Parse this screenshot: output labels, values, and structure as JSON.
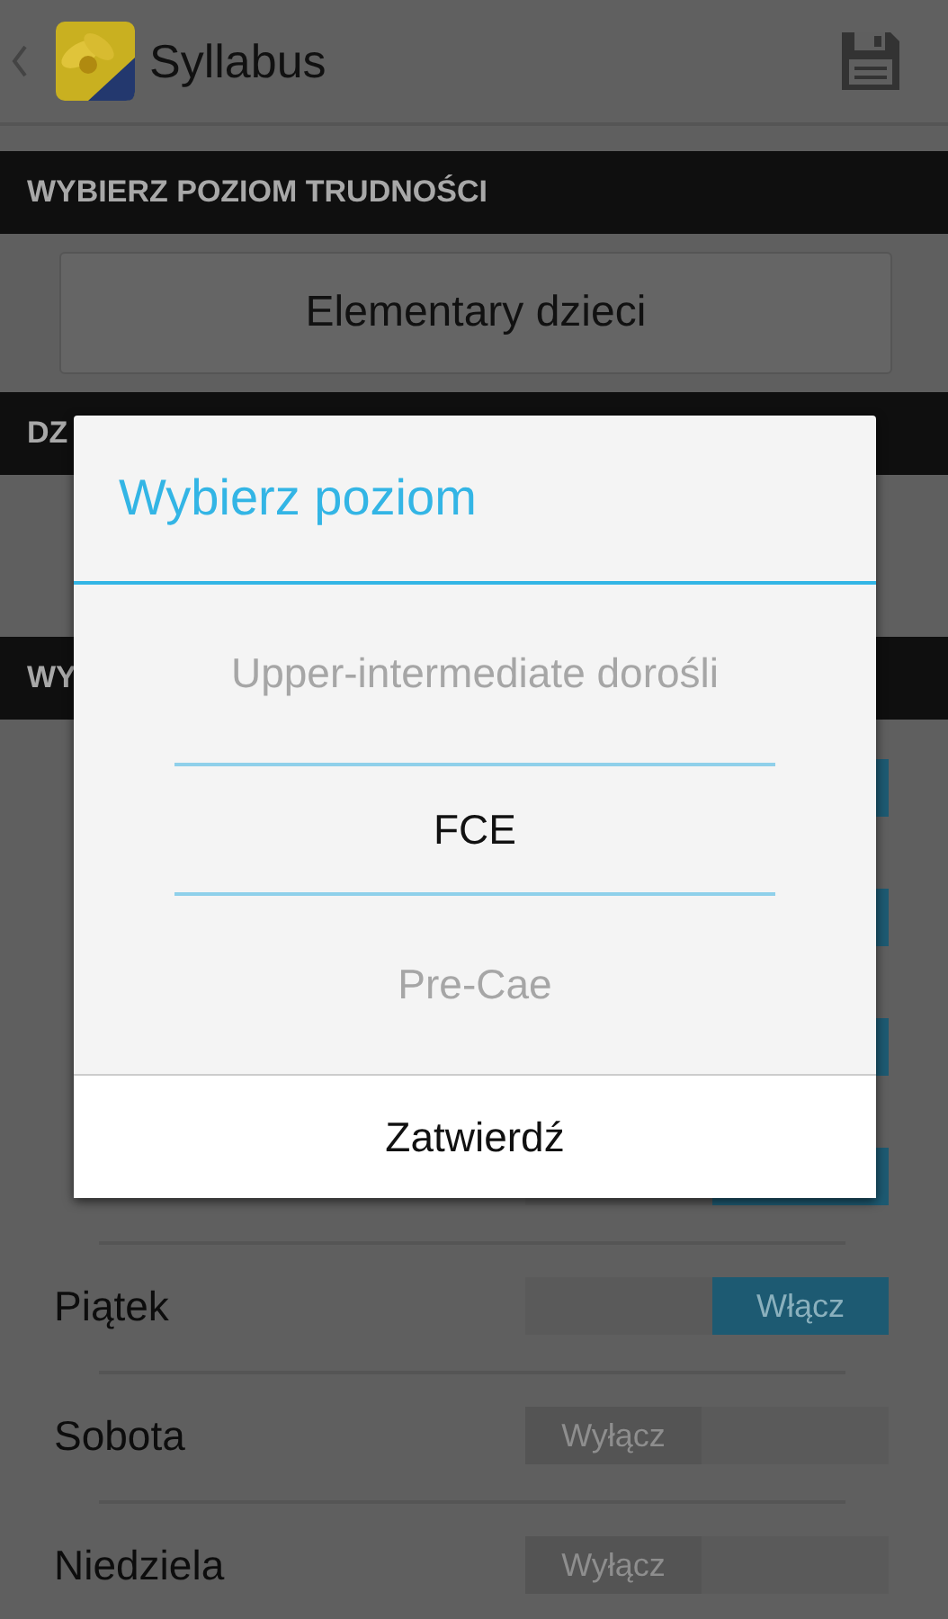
{
  "action_bar": {
    "title": "Syllabus"
  },
  "sections": [
    {
      "header": "WYBIERZ POZIOM TRUDNOŚCI",
      "kind": "button",
      "button": "Elementary dzieci"
    },
    {
      "header": "DZ",
      "kind": "blank"
    },
    {
      "header": "WY",
      "kind": "toggles",
      "rows": [
        {
          "on": true
        },
        {
          "on": true
        },
        {
          "on": true
        },
        {
          "on": true
        },
        {
          "label": "Piątek",
          "on": true,
          "state_text": "Włącz"
        },
        {
          "label": "Sobota",
          "on": false,
          "state_text": "Wyłącz"
        },
        {
          "label": "Niedziela",
          "on": false,
          "state_text": "Wyłącz"
        }
      ]
    }
  ],
  "dialog": {
    "title": "Wybierz poziom",
    "options": [
      {
        "label": "Upper-intermediate dorośli",
        "selected": false
      },
      {
        "label": "FCE",
        "selected": true
      },
      {
        "label": "Pre-Cae",
        "selected": false
      }
    ],
    "confirm": "Zatwierdź"
  }
}
